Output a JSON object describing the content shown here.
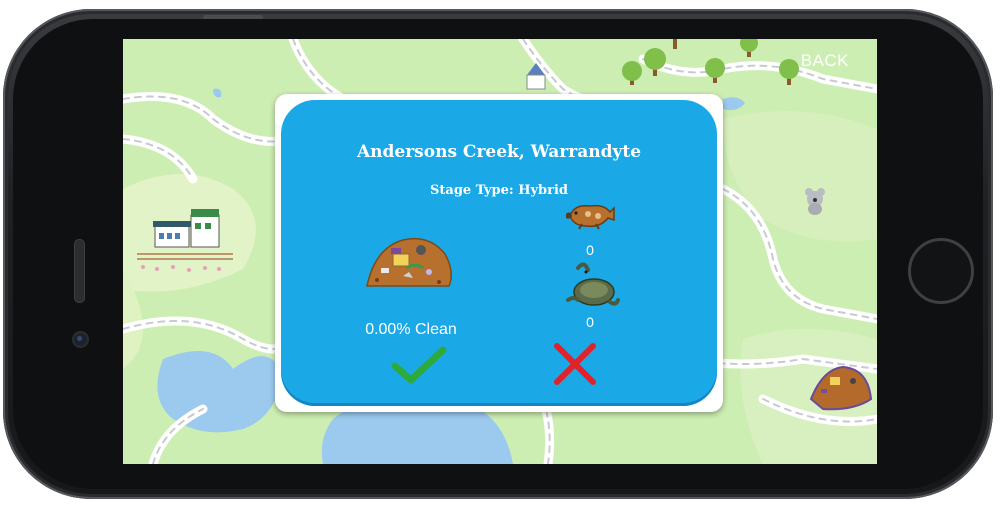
{
  "screen": {
    "back_label": "BACK"
  },
  "dialog": {
    "location_title": "Andersons Creek, Warrandyte",
    "stage_type": "Stage Type: Hybrid",
    "clean_percent": "0.00% Clean",
    "platypus_count": "0",
    "turtle_count": "0"
  },
  "colors": {
    "map_grass": "#cdeeb2",
    "dialog_blue": "#1aa9e6",
    "accept_green": "#2eaa3c",
    "reject_red": "#e0232a"
  },
  "icons": [
    "trash-pile-icon",
    "platypus-icon",
    "turtle-icon",
    "check-icon",
    "cross-icon",
    "koala-icon"
  ]
}
